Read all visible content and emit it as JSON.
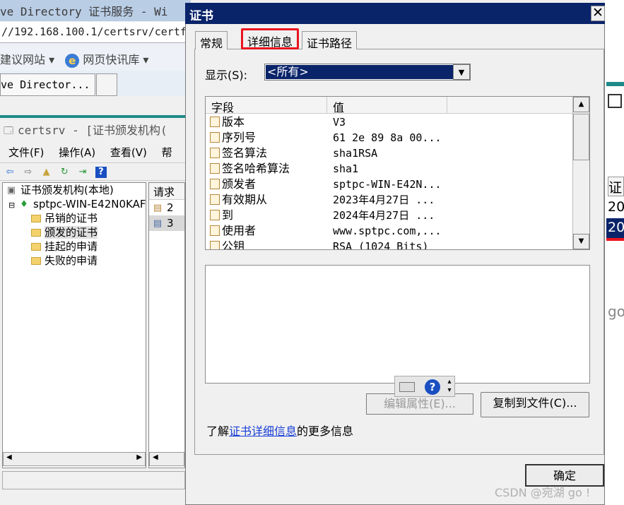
{
  "ie": {
    "title": "ve Directory 证书服务 - Wi",
    "address": "//192.168.100.1/certsrv/certf",
    "favorites": [
      "建议网站 ▾",
      "网页快讯库 ▾"
    ],
    "tab_label": "ve Director..."
  },
  "mmc": {
    "title": "certsrv - [证书颁发机构(",
    "menu": [
      "文件(F)",
      "操作(A)",
      "查看(V)",
      "帮"
    ],
    "tree": {
      "root": "证书颁发机构(本地)",
      "ca": "sptpc-WIN-E42N0KAF",
      "folders": [
        "吊销的证书",
        "颁发的证书",
        "挂起的申请",
        "失败的申请"
      ]
    },
    "list": {
      "header": "请求",
      "rows": [
        "2",
        "3"
      ]
    }
  },
  "right_strip": {
    "cells": [
      "证",
      "20",
      "20",
      "go"
    ]
  },
  "dialog": {
    "title": "证书",
    "close": "✕",
    "tabs": [
      "常规",
      "详细信息",
      "证书路径"
    ],
    "active_tab": "详细信息",
    "show": {
      "label": "显示(S):",
      "value": "<所有>"
    },
    "fields": {
      "col_field": "字段",
      "col_value": "值",
      "rows": [
        {
          "field": "版本",
          "value": "V3"
        },
        {
          "field": "序列号",
          "value": "61 2e 89 8a 00..."
        },
        {
          "field": "签名算法",
          "value": "sha1RSA"
        },
        {
          "field": "签名哈希算法",
          "value": "sha1"
        },
        {
          "field": "颁发者",
          "value": "sptpc-WIN-E42N..."
        },
        {
          "field": "有效期从",
          "value": "2023年4月27日 ..."
        },
        {
          "field": "到",
          "value": "2024年4月27日 ..."
        },
        {
          "field": "使用者",
          "value": "www.sptpc.com,..."
        },
        {
          "field": "公钥",
          "value": "RSA (1024 Bits)"
        }
      ]
    },
    "edit_button": "编辑属性(E)...",
    "copy_button": "复制到文件(C)...",
    "learn_prefix": "了解",
    "learn_link": "证书详细信息",
    "learn_suffix": "的更多信息",
    "ok_button": "确定"
  },
  "watermark": "CSDN @宛湖 go !",
  "colors": {
    "title_bar": "#0a246a",
    "highlight_box": "#e8141e",
    "teal_accent": "#1f8a8a",
    "link": "#1a3fd6"
  }
}
